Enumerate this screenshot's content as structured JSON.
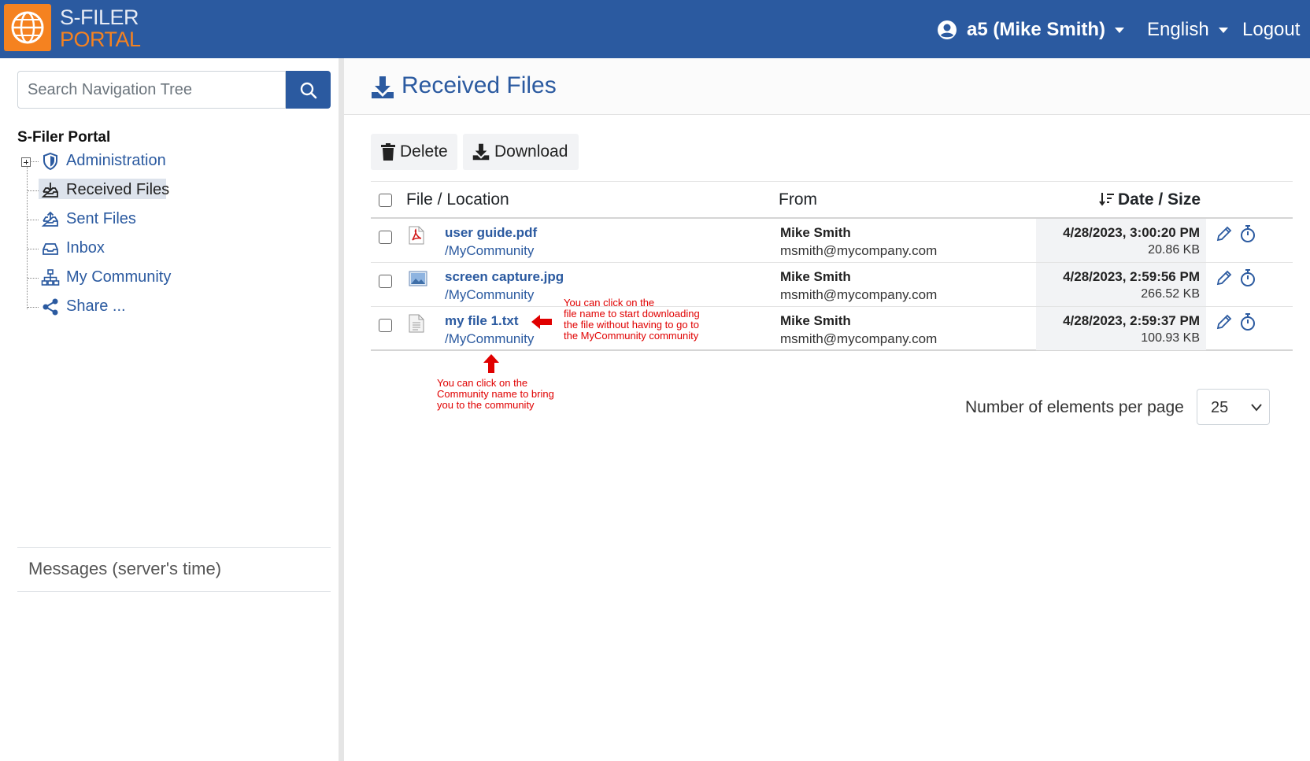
{
  "app": {
    "brand_line1": "S-FILER",
    "brand_line2": "PORTAL",
    "accent_color": "#2b5aa0",
    "logo_color": "#f58220"
  },
  "header": {
    "user_label": "a5 (Mike Smith)",
    "language": "English",
    "logout": "Logout"
  },
  "sidebar": {
    "search_placeholder": "Search Navigation Tree",
    "tree_root": "S-Filer Portal",
    "items": [
      {
        "label": "Administration",
        "icon": "shield-icon"
      },
      {
        "label": "Received Files",
        "icon": "inbox-download-icon"
      },
      {
        "label": "Sent Files",
        "icon": "inbox-upload-icon"
      },
      {
        "label": "Inbox",
        "icon": "inbox-icon"
      },
      {
        "label": "My Community",
        "icon": "sitemap-icon"
      },
      {
        "label": "Share ...",
        "icon": "share-icon"
      }
    ],
    "messages_label": "Messages (server's time)"
  },
  "main": {
    "title": "Received Files",
    "toolbar": {
      "delete_label": "Delete",
      "download_label": "Download"
    },
    "columns": {
      "file": "File / Location",
      "from": "From",
      "date": "Date / Size"
    },
    "rows": [
      {
        "name": "user guide.pdf",
        "location": "/MyCommunity",
        "from_name": "Mike Smith",
        "from_email": "msmith@mycompany.com",
        "date": "4/28/2023, 3:00:20 PM",
        "size": "20.86 KB",
        "icon": "pdf-file-icon"
      },
      {
        "name": "screen capture.jpg",
        "location": "/MyCommunity",
        "from_name": "Mike Smith",
        "from_email": "msmith@mycompany.com",
        "date": "4/28/2023, 2:59:56 PM",
        "size": "266.52 KB",
        "icon": "image-file-icon"
      },
      {
        "name": "my file 1.txt",
        "location": "/MyCommunity",
        "from_name": "Mike Smith",
        "from_email": "msmith@mycompany.com",
        "date": "4/28/2023, 2:59:37 PM",
        "size": "100.93 KB",
        "icon": "text-file-icon"
      }
    ],
    "annotations": {
      "file_note": [
        "You can click on the",
        "file name to start downloading",
        "the file without having to go to",
        "the MyCommunity community"
      ],
      "community_note": [
        "You can click on the",
        "Community name to bring",
        "you to the community"
      ],
      "color": "#e00000"
    },
    "pager": {
      "label": "Number of elements per page",
      "value": "25"
    }
  }
}
